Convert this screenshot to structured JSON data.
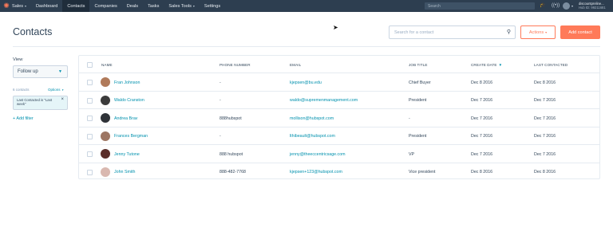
{
  "topnav": {
    "items": [
      {
        "label": "Sales",
        "dropdown": true
      },
      {
        "label": "Dashboard",
        "dropdown": false
      },
      {
        "label": "Contacts",
        "dropdown": false,
        "active": true
      },
      {
        "label": "Companies",
        "dropdown": false
      },
      {
        "label": "Deals",
        "dropdown": false
      },
      {
        "label": "Tasks",
        "dropdown": false
      },
      {
        "label": "Sales Tools",
        "dropdown": true
      },
      {
        "label": "Settings",
        "dropdown": false
      }
    ],
    "search_placeholder": "Search",
    "account_name": "discountpreline...",
    "hub_id": "Hub ID: 99211681"
  },
  "header": {
    "title": "Contacts",
    "search_placeholder": "Search for a contact",
    "actions_label": "Actions",
    "add_label": "Add contact"
  },
  "sidebar": {
    "view_label": "View",
    "view_selected": "Follow up",
    "contact_count": "6 contacts",
    "options_label": "Options",
    "filter_text": "Last Contacted is \"Last week\"",
    "add_filter_label": "Add filter"
  },
  "table": {
    "columns": [
      "NAME",
      "PHONE NUMBER",
      "EMAIL",
      "JOB TITLE",
      "CREATE DATE",
      "LAST CONTACTED"
    ],
    "rows": [
      {
        "name": "Fran Johnson",
        "phone": "-",
        "email": "kjepsen@bu.edu",
        "job": "Chief Buyer",
        "created": "Dec 8 2016",
        "last": "Dec 8 2016",
        "avatar_color": "#b07a5a"
      },
      {
        "name": "Waldo Cranston",
        "phone": "-",
        "email": "waldo@supremenmanagement.com",
        "job": "President",
        "created": "Dec 7 2016",
        "last": "Dec 7 2016",
        "avatar_color": "#3b3b3b"
      },
      {
        "name": "Andrea Brav",
        "phone": "888hubspot",
        "email": "mollison@hubspot.com",
        "job": "-",
        "created": "Dec 7 2016",
        "last": "Dec 7 2016",
        "avatar_color": "#2f3338"
      },
      {
        "name": "Frances Bergman",
        "phone": "-",
        "email": "lthibeault@hubspot.com",
        "job": "President",
        "created": "Dec 7 2016",
        "last": "Dec 7 2016",
        "avatar_color": "#9d7663"
      },
      {
        "name": "Jenny Tutone",
        "phone": "888 hubspot",
        "email": "jenny@theeccentricsage.com",
        "job": "VP",
        "created": "Dec 7 2016",
        "last": "Dec 7 2016",
        "avatar_color": "#5a2e2a"
      },
      {
        "name": "John Smith",
        "phone": "888-482-7768",
        "email": "kjepsen+123@hubspot.com",
        "job": "Vice president",
        "created": "Dec 8 2016",
        "last": "Dec 8 2016",
        "avatar_color": "#d9b8b0"
      }
    ]
  },
  "colors": {
    "nav_bg": "#2d3e50",
    "accent": "#ff7a59",
    "link": "#0091ae",
    "text": "#33475b"
  }
}
